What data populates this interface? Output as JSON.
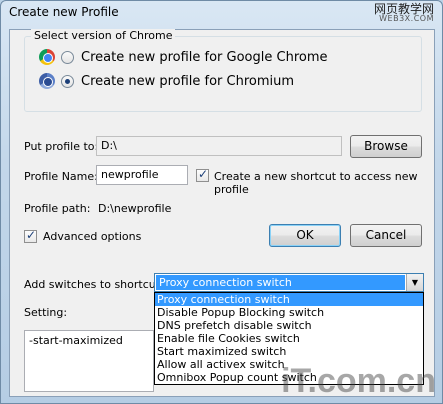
{
  "window": {
    "title": "Create new Profile"
  },
  "watermark": {
    "top_cn": "网页教学网",
    "top_url": "WEB3X.COM",
    "bottom": "iT.com.cn"
  },
  "version_group": {
    "legend": "Select version of Chrome",
    "options": [
      {
        "label": "Create new profile for Google Chrome",
        "checked": false,
        "icon": "chrome-icon"
      },
      {
        "label": "Create new profile for Chromium",
        "checked": true,
        "icon": "chromium-icon"
      }
    ]
  },
  "put_profile": {
    "label": "Put profile to:",
    "value": "D:\\",
    "browse_label": "Browse"
  },
  "profile_name": {
    "label": "Profile Name:",
    "value": "newprofile",
    "shortcut_label": "Create a new shortcut to access new profile",
    "shortcut_checked": true
  },
  "profile_path": {
    "label": "Profile path:",
    "value": "D:\\newprofile"
  },
  "advanced": {
    "label": "Advanced options",
    "checked": true
  },
  "buttons": {
    "ok": "OK",
    "cancel": "Cancel"
  },
  "switches": {
    "label": "Add switches to shortcut:",
    "selected": "Proxy connection switch",
    "options": [
      "Proxy connection switch",
      "Disable Popup Blocking switch",
      "DNS prefetch disable switch",
      "Enable file Cookies switch",
      "Start maximized switch",
      "Allow all activex switch",
      "Omnibox Popup count switch"
    ]
  },
  "setting": {
    "label": "Setting:",
    "value": "-start-maximized"
  },
  "colors": {
    "selection": "#3399ff",
    "dialog_bg": "#f0f0f0"
  }
}
